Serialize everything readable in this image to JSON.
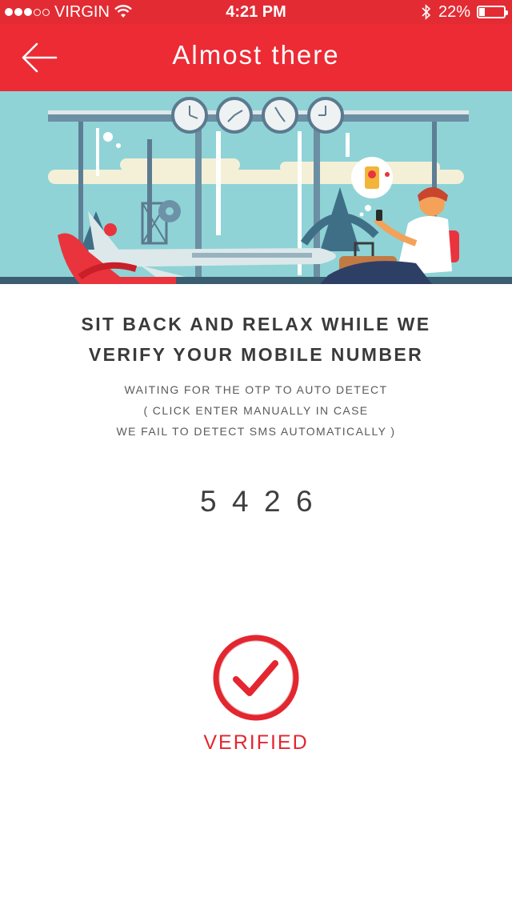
{
  "status_bar": {
    "carrier": "VIRGIN",
    "time": "4:21 PM",
    "battery": "22%",
    "battery_level": 0.22,
    "icons": [
      "signal-dots-icon",
      "wifi-icon",
      "bluetooth-icon",
      "battery-icon"
    ]
  },
  "nav": {
    "title": "Almost there",
    "back_icon": "arrow-left-icon"
  },
  "content": {
    "heading_line1": "SIT BACK AND RELAX WHILE WE",
    "heading_line2": "VERIFY YOUR MOBILE NUMBER",
    "sub_line1": "WAITING FOR THE OTP TO AUTO DETECT",
    "sub_line2": "( CLICK ENTER MANUALLY IN CASE",
    "sub_line3": "WE FAIL TO DETECT SMS AUTOMATICALLY )",
    "otp": [
      "5",
      "4",
      "2",
      "6"
    ],
    "verified_label": "VERIFIED"
  },
  "colors": {
    "brand_red": "#ec2b35",
    "status_red": "#e32b33",
    "sky": "#8fd3d6",
    "text_dark": "#3a3a3a"
  }
}
